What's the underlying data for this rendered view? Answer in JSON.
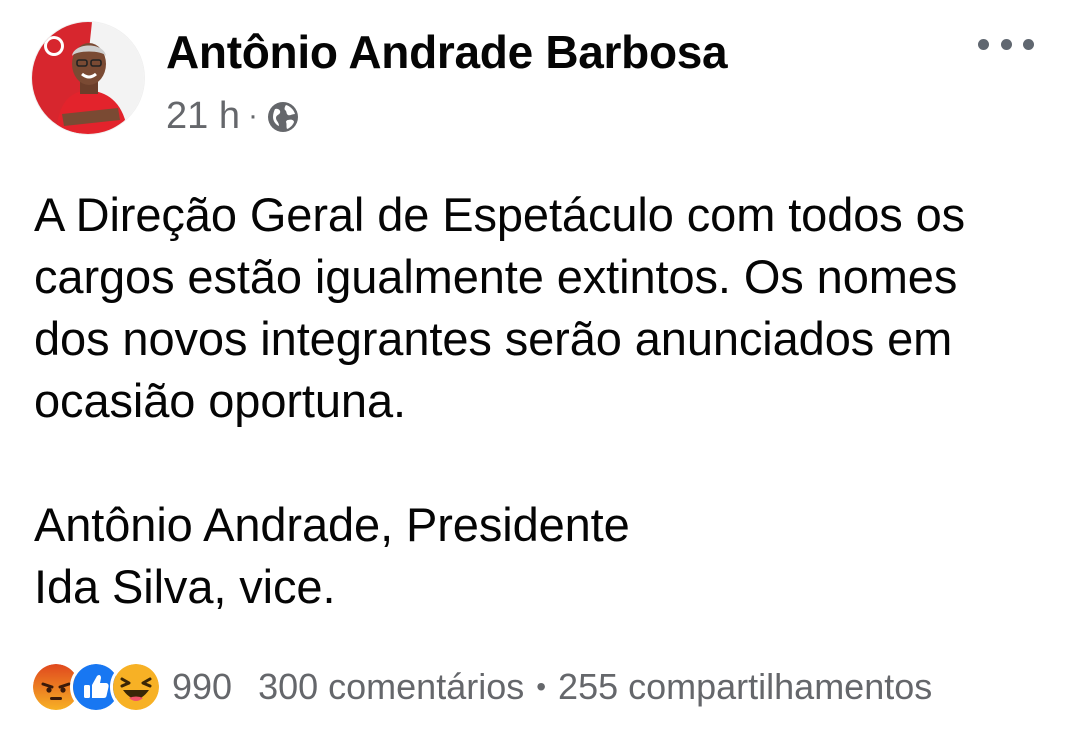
{
  "post": {
    "author": "Antônio Andrade Barbosa",
    "timestamp": "21 h",
    "separator": "·",
    "privacy_icon": "globe-icon",
    "more_icon": "more-horizontal-icon",
    "text_lines": [
      "A Direção Geral de Espetáculo com todos os",
      "cargos estão igualmente extintos. Os nomes",
      "dos novos integrantes serão anunciados em",
      "ocasião oportuna.",
      "Antônio Andrade, Presidente",
      "Ida Silva, vice."
    ]
  },
  "engagement": {
    "reactions": [
      "angry-icon",
      "like-icon",
      "haha-icon"
    ],
    "reaction_count": "990",
    "comments": "300 comentários",
    "bullet": "•",
    "shares": "255 compartilhamentos"
  },
  "colors": {
    "secondary_text": "#65676b",
    "like_blue": "#1877f2",
    "reaction_yellow": "#f7b125",
    "angry_orange": "#e9710f",
    "avatar_red": "#d7262e"
  }
}
